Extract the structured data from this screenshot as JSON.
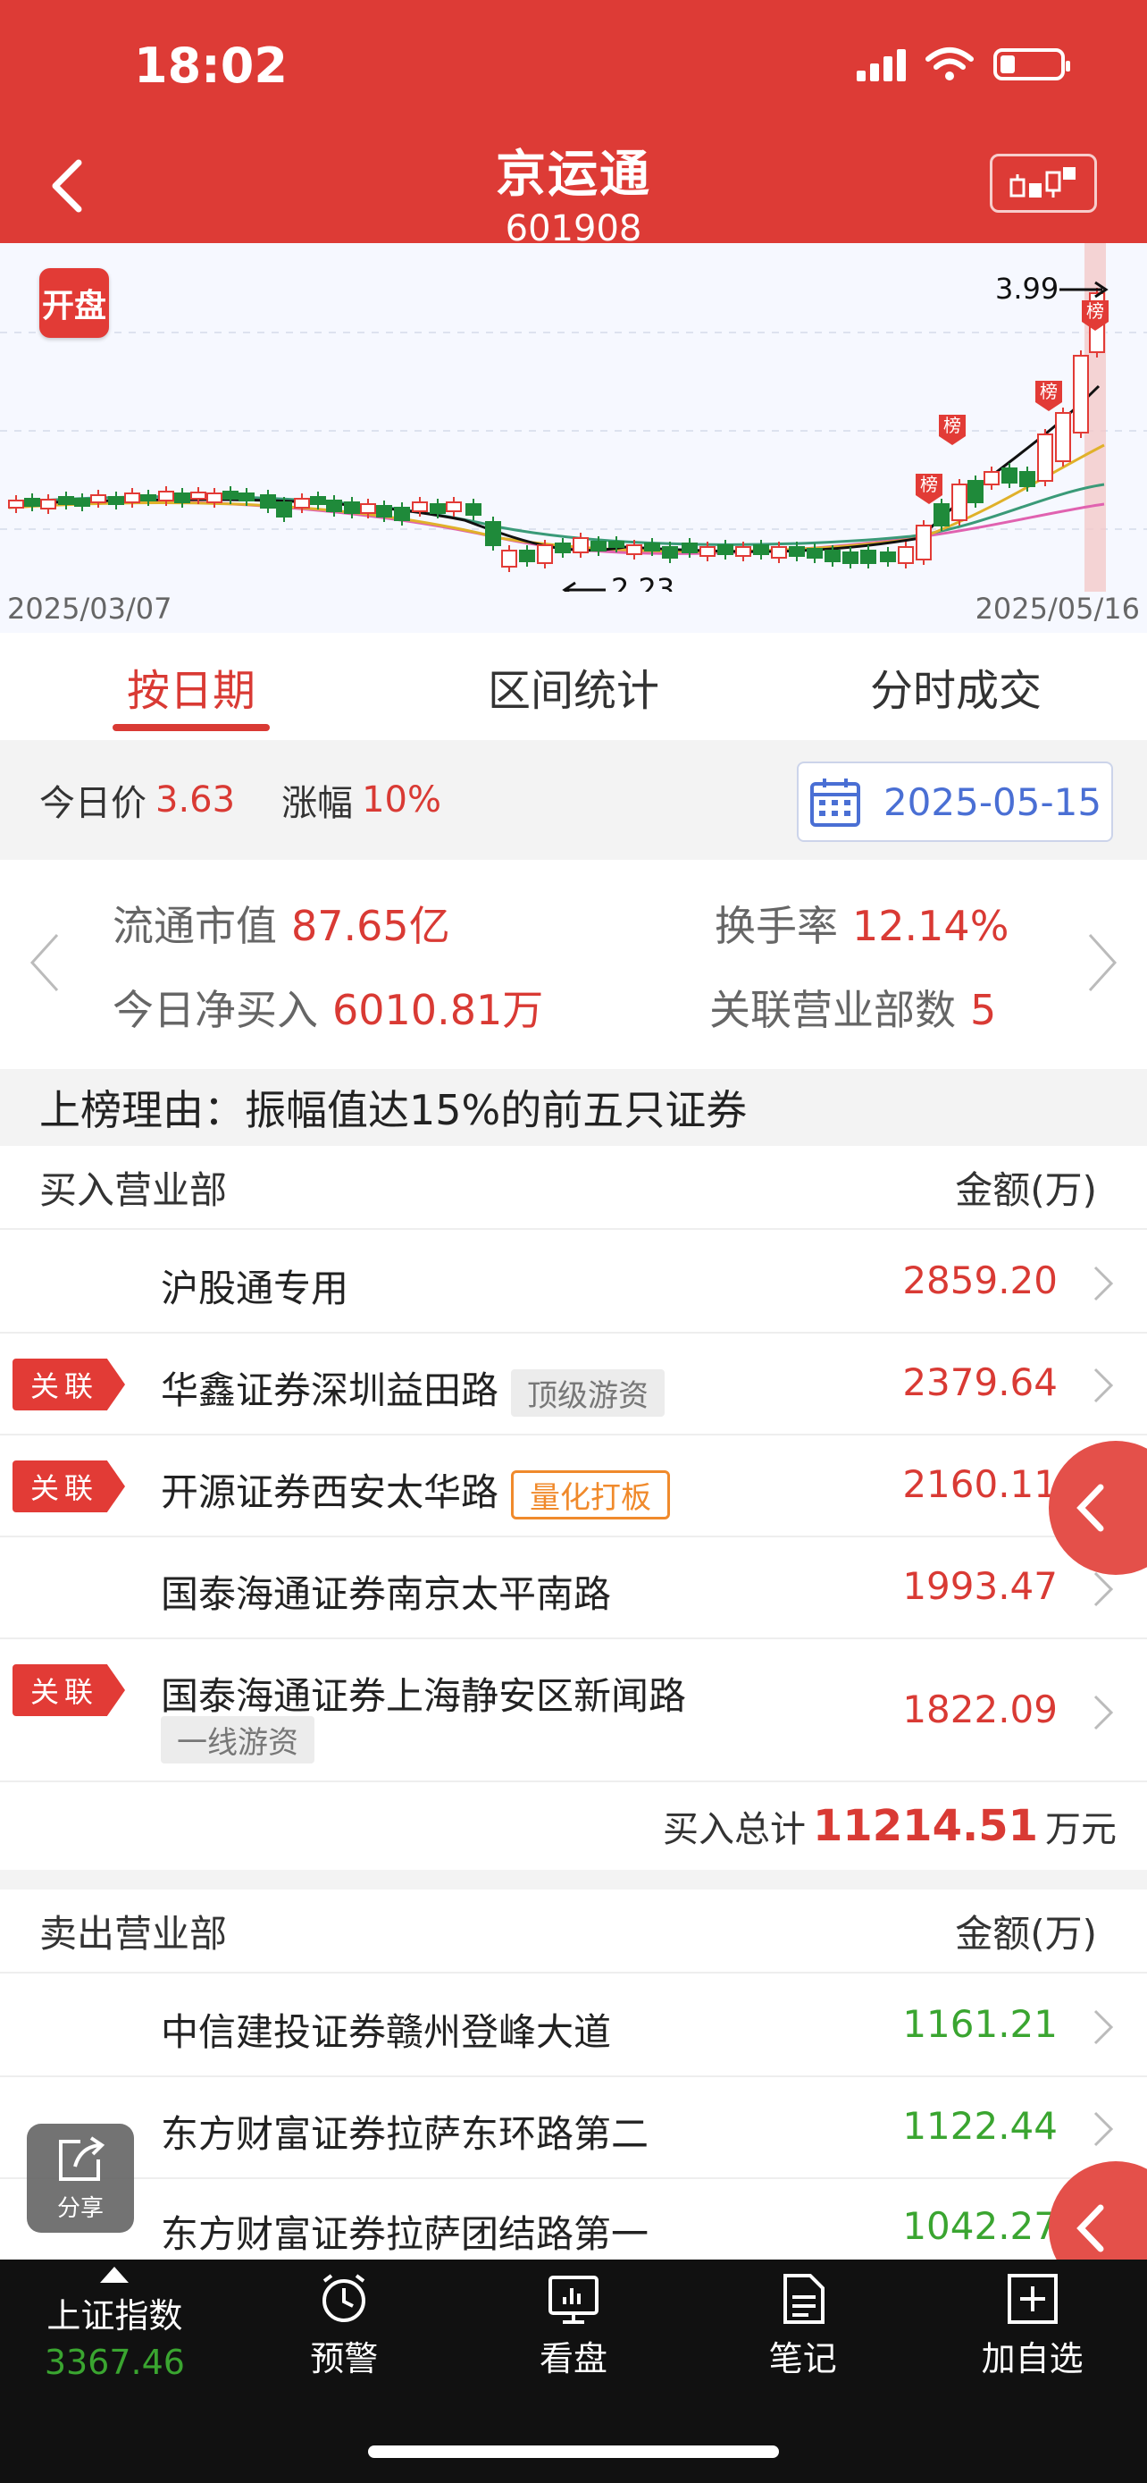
{
  "status": {
    "time": "18:02"
  },
  "header": {
    "title": "京运通",
    "code": "601908"
  },
  "chart": {
    "badge": "开盘",
    "start_date": "2025/03/07",
    "end_date": "2025/05/16",
    "high_label": "3.99",
    "low_label": "2.23",
    "rank_marker": "榜"
  },
  "tabs": [
    {
      "label": "按日期",
      "active": true
    },
    {
      "label": "区间统计",
      "active": false
    },
    {
      "label": "分时成交",
      "active": false
    }
  ],
  "info": {
    "price_label": "今日价",
    "price": "3.63",
    "change_label": "涨幅",
    "change": "10%",
    "date": "2025-05-15"
  },
  "stats": {
    "float_cap_label": "流通市值",
    "float_cap": "87.65亿",
    "turnover_label": "换手率",
    "turnover": "12.14%",
    "net_buy_label": "今日净买入",
    "net_buy": "6010.81万",
    "branches_label": "关联营业部数",
    "branches": "5"
  },
  "reason": "上榜理由：振幅值达15%的前五只证券",
  "buy": {
    "header": "买入营业部",
    "amount_header": "金额(万)",
    "rows": [
      {
        "name": "沪股通专用",
        "amount": "2859.20",
        "related": false,
        "tag": ""
      },
      {
        "name": "华鑫证券深圳益田路",
        "amount": "2379.64",
        "related": true,
        "tag": "顶级游资"
      },
      {
        "name": "开源证券西安太华路",
        "amount": "2160.11",
        "related": true,
        "tag": "量化打板"
      },
      {
        "name": "国泰海通证券南京太平南路",
        "amount": "1993.47",
        "related": false,
        "tag": ""
      },
      {
        "name": "国泰海通证券上海静安区新闻路",
        "amount": "1822.09",
        "related": true,
        "tag": "一线游资"
      }
    ],
    "related_label": "关联",
    "total_label": "买入总计",
    "total": "11214.51",
    "total_unit": "万元"
  },
  "sell": {
    "header": "卖出营业部",
    "amount_header": "金额(万)",
    "rows": [
      {
        "name": "中信建投证券赣州登峰大道",
        "amount": "1161.21"
      },
      {
        "name": "东方财富证券拉萨东环路第二",
        "amount": "1122.44"
      },
      {
        "name": "东方财富证券拉萨团结路第一",
        "amount": "1042.27"
      }
    ]
  },
  "share_label": "分享",
  "nav": {
    "index_label": "上证指数",
    "index_value": "3367.46",
    "items": [
      "预警",
      "看盘",
      "笔记",
      "加自选"
    ]
  },
  "colors": {
    "brand": "#dd3b36",
    "up": "#d93a34",
    "down": "#3aa530",
    "link": "#4a6fd4"
  }
}
